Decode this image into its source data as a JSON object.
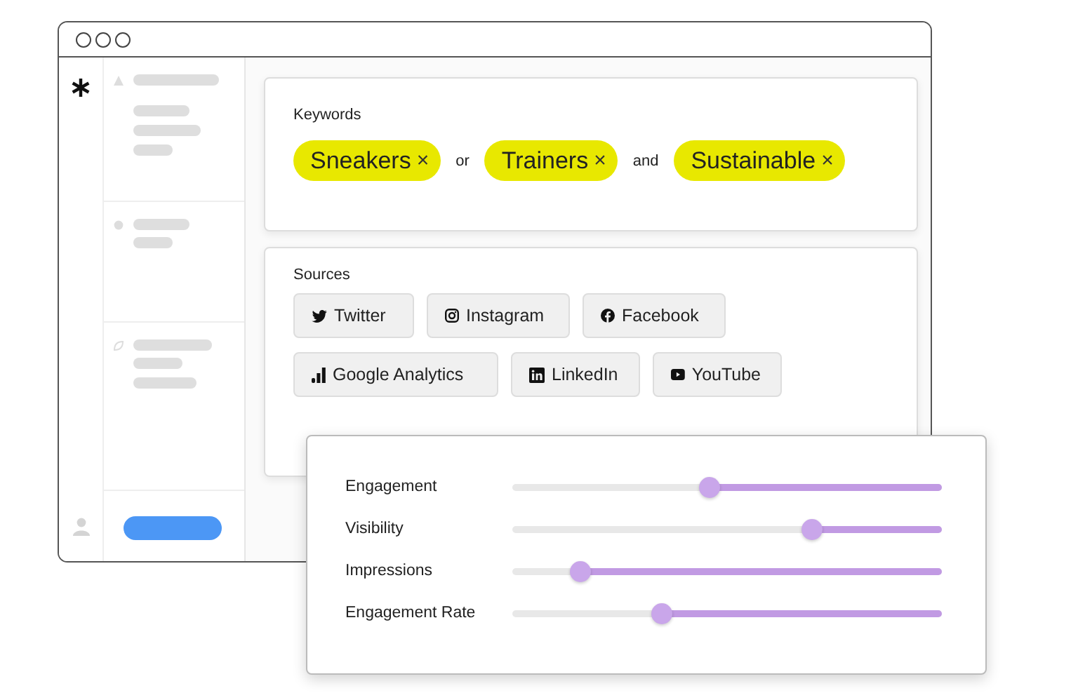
{
  "keywords": {
    "title": "Keywords",
    "terms": [
      {
        "kind": "chip",
        "label": "Sneakers",
        "remove": "×"
      },
      {
        "kind": "connector",
        "label": "or"
      },
      {
        "kind": "chip",
        "label": "Trainers",
        "remove": "×"
      },
      {
        "kind": "connector",
        "label": "and"
      },
      {
        "kind": "chip",
        "label": "Sustainable",
        "remove": "×"
      }
    ]
  },
  "sources": {
    "title": "Sources",
    "items": [
      {
        "label": "Twitter"
      },
      {
        "label": "Instagram"
      },
      {
        "label": "Facebook"
      },
      {
        "label": "Google Analytics"
      },
      {
        "label": "LinkedIn"
      },
      {
        "label": "YouTube"
      }
    ]
  },
  "metrics": [
    {
      "label": "Engagement",
      "level": 0.46
    },
    {
      "label": "Visibility",
      "level": 0.7
    },
    {
      "label": "Impressions",
      "level": 0.16
    },
    {
      "label": "Engagement Rate",
      "level": 0.35
    }
  ]
}
